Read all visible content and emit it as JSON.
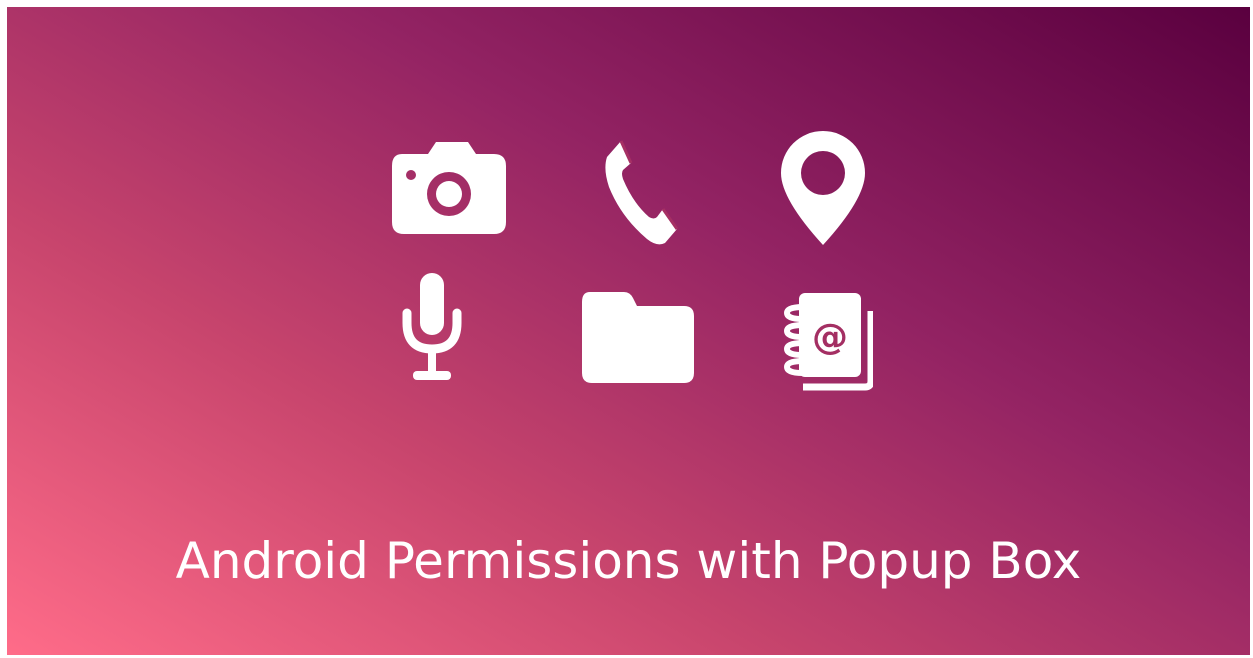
{
  "banner": {
    "title": "Android Permissions with Popup Box",
    "background_colors": [
      "#ff6c89",
      "#c8456d",
      "#932363",
      "#5a003f"
    ],
    "text_color": "#ffffff"
  },
  "icons": [
    {
      "name": "camera-icon"
    },
    {
      "name": "phone-icon"
    },
    {
      "name": "location-pin-icon"
    },
    {
      "name": "microphone-icon"
    },
    {
      "name": "folder-icon"
    },
    {
      "name": "contacts-book-icon"
    }
  ]
}
